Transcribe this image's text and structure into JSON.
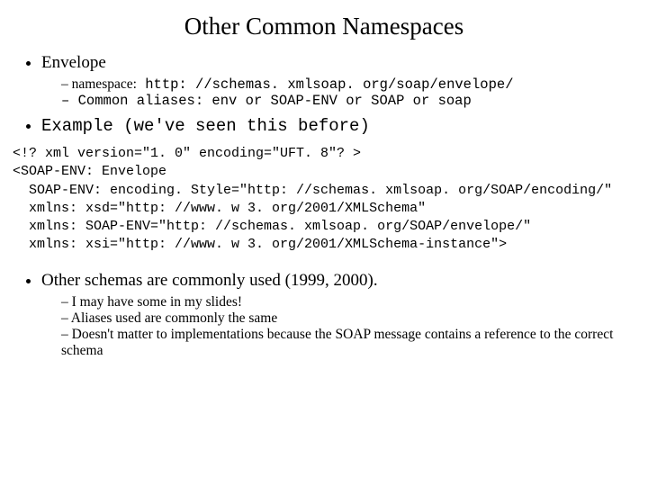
{
  "title": "Other Common Namespaces",
  "b1": {
    "label": "Envelope",
    "s1a": "namespace:",
    "s1b": " http: //schemas. xmlsoap. org/soap/envelope/",
    "s2": "Common aliases: env or SOAP-ENV or SOAP or soap"
  },
  "b2": "Example (we've seen this before)",
  "code": "<!? xml version=\"1. 0\" encoding=\"UFT. 8\"? >\n<SOAP-ENV: Envelope\n  SOAP-ENV: encoding. Style=\"http: //schemas. xmlsoap. org/SOAP/encoding/\"\n  xmlns: xsd=\"http: //www. w 3. org/2001/XMLSchema\"\n  xmlns: SOAP-ENV=\"http: //schemas. xmlsoap. org/SOAP/envelope/\"\n  xmlns: xsi=\"http: //www. w 3. org/2001/XMLSchema-instance\">",
  "b3": {
    "label": "Other schemas are commonly used (1999, 2000).",
    "s1": "I may have some in my slides!",
    "s2": "Aliases used are commonly the same",
    "s3": "Doesn't matter to implementations because the SOAP message contains a reference to the correct schema"
  }
}
